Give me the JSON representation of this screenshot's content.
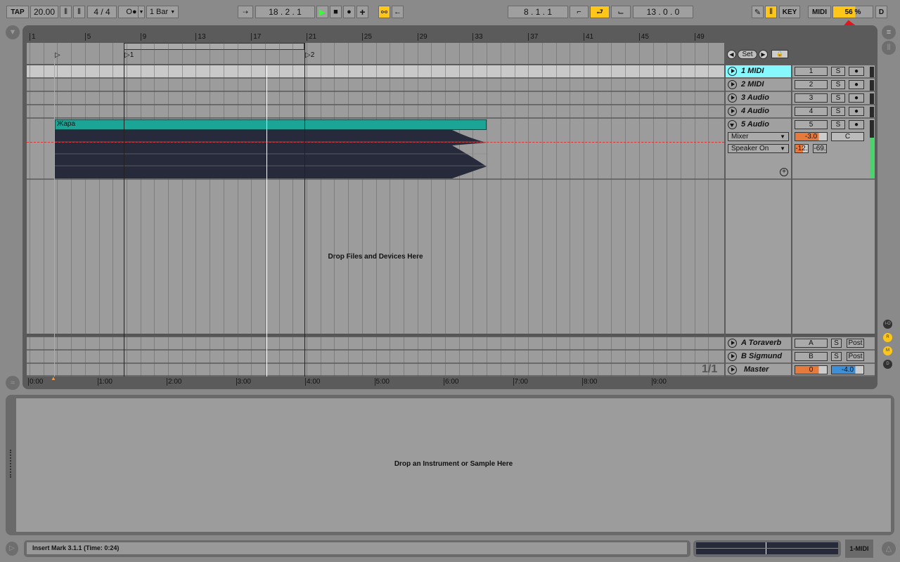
{
  "toolbar": {
    "tap": "TAP",
    "tempo": "20.00",
    "signature": "4 / 4",
    "metronome": "O●",
    "quantize": "1 Bar",
    "position": "18 .  2 .  1",
    "loop_start": "8 .  1 .  1",
    "loop_length": "13 .  0 .  0",
    "key": "KEY",
    "midi": "MIDI",
    "cpu": "56",
    "cpu_unit": "%",
    "d": "D"
  },
  "ruler": {
    "bars": [
      "1",
      "5",
      "9",
      "13",
      "17",
      "21",
      "25",
      "29",
      "33",
      "37",
      "41",
      "45",
      "49"
    ],
    "locators": [
      "1",
      "2"
    ],
    "times": [
      "0:00",
      "1:00",
      "2:00",
      "3:00",
      "4:00",
      "5:00",
      "6:00",
      "7:00",
      "8:00",
      "9:00"
    ]
  },
  "locator_controls": {
    "set": "Set"
  },
  "tracks": [
    {
      "name": "1 MIDI",
      "number": "1",
      "solo": "S"
    },
    {
      "name": "2 MIDI",
      "number": "2",
      "solo": "S"
    },
    {
      "name": "3 Audio",
      "number": "3",
      "solo": "S"
    },
    {
      "name": "4 Audio",
      "number": "4",
      "solo": "S"
    },
    {
      "name": "5 Audio",
      "number": "5",
      "solo": "S",
      "input_type": "Mixer",
      "input_channel": "Speaker On",
      "volume": "-3.0",
      "pan": "C",
      "send_a": "-12.",
      "send_b": "-69."
    }
  ],
  "clip": {
    "name": "Жара"
  },
  "drop_text": "Drop Files and Devices Here",
  "returns": [
    {
      "name": "A Toraverb",
      "letter": "A",
      "solo": "S",
      "post": "Post"
    },
    {
      "name": "B Sigmund",
      "letter": "B",
      "solo": "S",
      "post": "Post"
    }
  ],
  "master": {
    "name": "Master",
    "cue": "0",
    "volume": "-4.0"
  },
  "page_indicator": "1/1",
  "side_buttons": [
    "I-O",
    "R",
    "M",
    "D"
  ],
  "detail": {
    "drop_text": "Drop an Instrument or Sample Here"
  },
  "status": {
    "text": "Insert Mark 3.1.1 (Time: 0:24)",
    "selected_track": "1-MIDI"
  },
  "colors": {
    "accent": "#ffc61a",
    "clip": "#1aa596",
    "selected_track": "#88f8ff",
    "waveform": "#262a3a"
  }
}
